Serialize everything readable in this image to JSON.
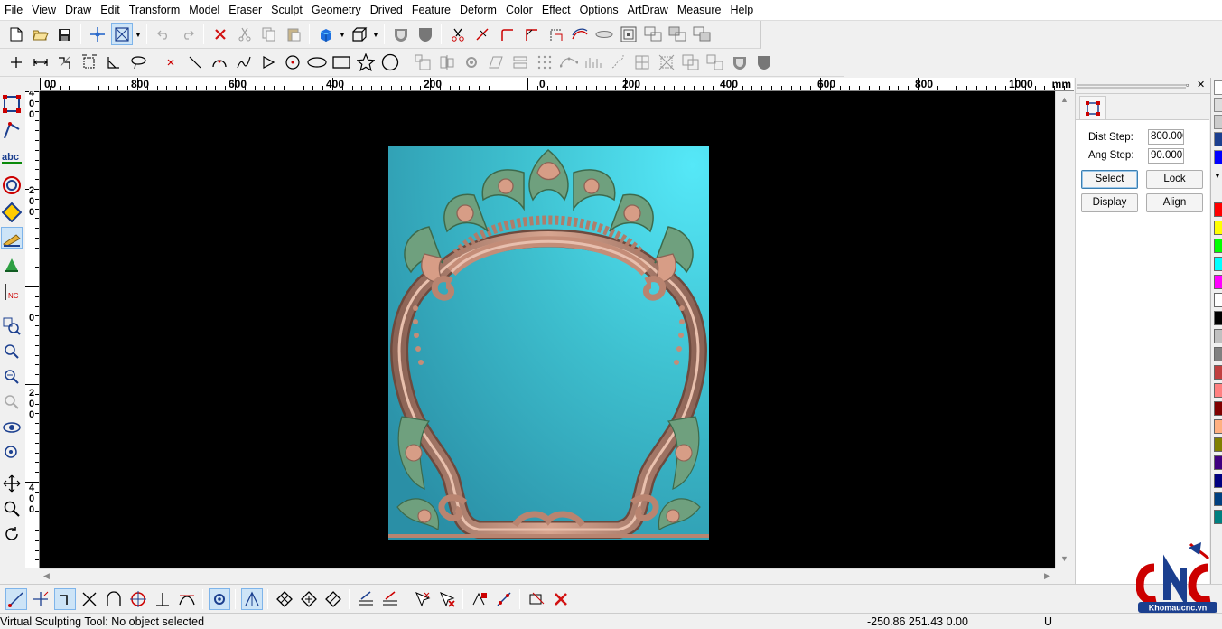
{
  "menu": [
    "File",
    "Edit",
    "Draw",
    "Edit",
    "Transform",
    "Model",
    "Eraser",
    "Sculpt",
    "Geometry",
    "Drived",
    "Feature",
    "Deform",
    "Color",
    "Effect",
    "Options",
    "ArtDraw",
    "Measure",
    "Help"
  ],
  "menu_real": [
    "File",
    "View",
    "Draw",
    "Edit",
    "Transform",
    "Model",
    "Eraser",
    "Sculpt",
    "Geometry",
    "Drived",
    "Feature",
    "Deform",
    "Color",
    "Effect",
    "Options",
    "ArtDraw",
    "Measure",
    "Help"
  ],
  "ruler": {
    "labels": [
      "00",
      "800",
      "600",
      "400",
      "200",
      "0",
      "200",
      "400",
      "600",
      "800",
      "1000"
    ],
    "unit": "mm"
  },
  "vruler": {
    "digits": [
      "4",
      "0",
      "0",
      "2",
      "0",
      "0",
      "0",
      "2",
      "0",
      "0",
      "4",
      "0",
      "0"
    ]
  },
  "panel": {
    "dist_step_label": "Dist Step:",
    "dist_step_value": "800.000",
    "ang_step_label": "Ang Step:",
    "ang_step_value": "90.000",
    "select_label": "Select",
    "lock_label": "Lock",
    "display_label": "Display",
    "align_label": "Align"
  },
  "status": {
    "message": "Virtual Sculpting Tool: No object selected",
    "coords": "-250.86 251.43 0.00",
    "mode": "U"
  },
  "logo": {
    "text": "CNC",
    "site": "Khomaucnc.vn"
  },
  "colors": {
    "viewport": "#000000",
    "relief_bg": "#3fb8c6",
    "relief_frame": "#c9927a",
    "relief_leaf": "#6fa07e",
    "accent": "#3c7fb1"
  },
  "palette": [
    "#ff0000",
    "#ffff00",
    "#00ff00",
    "#00ffff",
    "#ff00ff",
    "#ffffff",
    "#000000",
    "#c0c0c0",
    "#808080",
    "#c04040",
    "#ff8080",
    "#800000",
    "#ffb080",
    "#808000",
    "#400080",
    "#000080",
    "#004080",
    "#008080"
  ],
  "toolbar_top_icons": [
    "new-icon",
    "open-icon",
    "save-icon",
    "crosshair-icon",
    "select-box-icon",
    "undo-icon",
    "redo-icon",
    "delete-icon",
    "cut-icon",
    "copy-icon",
    "paste-icon",
    "cube-color-icon",
    "cube-wire-icon",
    "shield-icon",
    "shield-filled-icon",
    "scissors-icon",
    "line-cut-icon",
    "corner-icon",
    "corner-round-icon",
    "corner-dash-icon",
    "curve-offset-icon",
    "ellipse-flat-icon",
    "stamp-icon",
    "boolean-union-icon",
    "boolean-sub-icon",
    "boolean-inter-icon"
  ],
  "toolbar_second_icons": [
    "point-icon",
    "dimension-icon",
    "step-icon",
    "box-measure-icon",
    "angle-icon",
    "lasso-icon",
    "x-point-icon",
    "line-icon",
    "arc-icon",
    "spline-icon",
    "triangle-icon",
    "circle-point-icon",
    "ellipse-icon",
    "rectangle-icon",
    "star-icon",
    "circle-icon"
  ],
  "bottom_icons": [
    "snap-line-icon",
    "snap-end-icon",
    "snap-corner-icon",
    "snap-cross-icon",
    "snap-arc-icon",
    "snap-circle-icon",
    "snap-perp-icon",
    "snap-tangent-icon",
    "snap-grid-icon",
    "snap-intersect-icon",
    "diamond-1-icon",
    "diamond-2-icon",
    "diamond-3-icon",
    "layers-icon",
    "layers-2-icon",
    "cursor-x-icon",
    "cursor-red-icon",
    "pick-icon",
    "pick-2-icon",
    "transform-icon",
    "close-red-icon"
  ]
}
